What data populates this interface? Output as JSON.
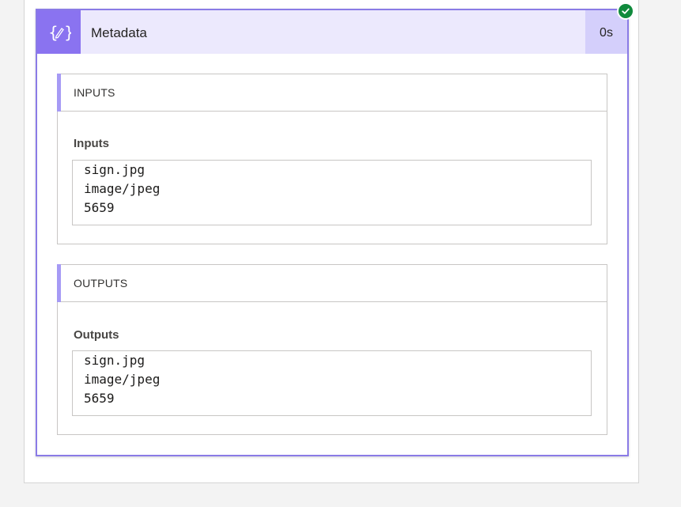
{
  "action": {
    "title": "Metadata",
    "duration": "0s",
    "icon": "braces-pencil-icon",
    "status": "succeeded",
    "accent_color": "#8a73f0",
    "header_bg": "#ece9fd",
    "success_color": "#108a3c"
  },
  "inputs_section": {
    "title": "INPUTS",
    "field_label": "Inputs",
    "lines": [
      "sign.jpg",
      "image/jpeg",
      "5659"
    ]
  },
  "outputs_section": {
    "title": "OUTPUTS",
    "field_label": "Outputs",
    "lines": [
      "sign.jpg",
      "image/jpeg",
      "5659"
    ]
  }
}
